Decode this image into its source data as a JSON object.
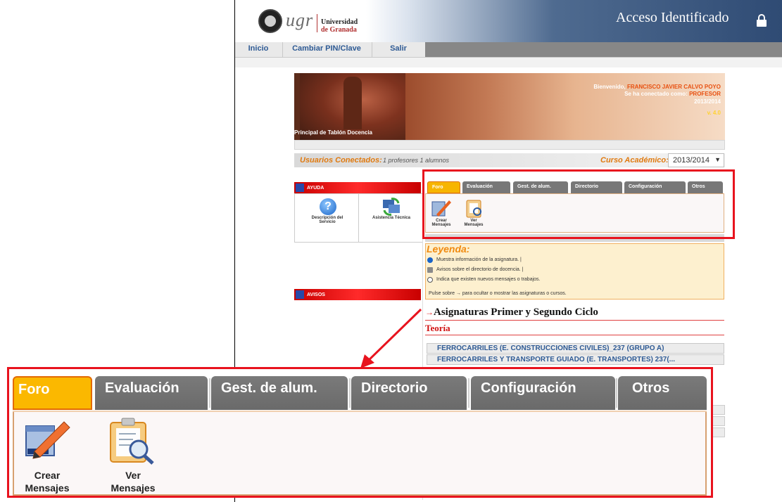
{
  "header": {
    "logo_ugr": "ugr",
    "logo_line1": "Universidad",
    "logo_line2": "de Granada",
    "acceso": "Acceso Identificado"
  },
  "nav": {
    "items": [
      "Inicio",
      "Cambiar PIN/Clave",
      "Salir"
    ]
  },
  "banner": {
    "bienvenido_prefix": "Bienvenido, ",
    "user_name": "FRANCISCO JAVIER CALVO POYO",
    "conectado_prefix": "Se ha conectado como: ",
    "role": "PROFESOR",
    "year": "2013/2014",
    "version": "v. 4.0",
    "caption": "Principal de Tablón Docencia"
  },
  "usuarios": {
    "label": "Usuarios Conectados:",
    "counts": "1  profesores     1  alumnos",
    "curso_label": "Curso Académico:",
    "curso_value": "2013/2014",
    "curso_arrow": "▼"
  },
  "left_panels": {
    "ayuda": "AYUDA",
    "avisos": "AVISOS",
    "descripcion": "Descripción del Servicio",
    "asistencia": "Asistencia Técnica"
  },
  "tabs": [
    "Foro",
    "Evaluación",
    "Gest. de alum.",
    "Directorio",
    "Configuración",
    "Otros"
  ],
  "tab_actions": {
    "crear_line1": "Crear",
    "crear_line2": "Mensajes",
    "ver_line1": "Ver",
    "ver_line2": "Mensajes"
  },
  "leyenda": {
    "title": "Leyenda:",
    "items": [
      "Muestra información de la asignatura.  |",
      "Avisos sobre el directorio de docencia.  |",
      "Indica que existen nuevos mensajes o trabajos."
    ],
    "pulse": "Pulse sobre  →   para ocultar o mostrar las asignaturas o cursos."
  },
  "asignaturas": {
    "title": "Asignaturas Primer y Segundo Ciclo",
    "section": "Teoría",
    "subjects": [
      "FERROCARRILES (E. CONSTRUCCIONES CIVILES)_237 (GRUPO A)",
      "FERROCARRILES Y TRANSPORTE GUIADO (E. TRANSPORTES) 237(..."
    ]
  },
  "colors": {
    "highlight": "#e8131e",
    "active_tab": "#fbb800",
    "inactive_tab": "#777777"
  }
}
